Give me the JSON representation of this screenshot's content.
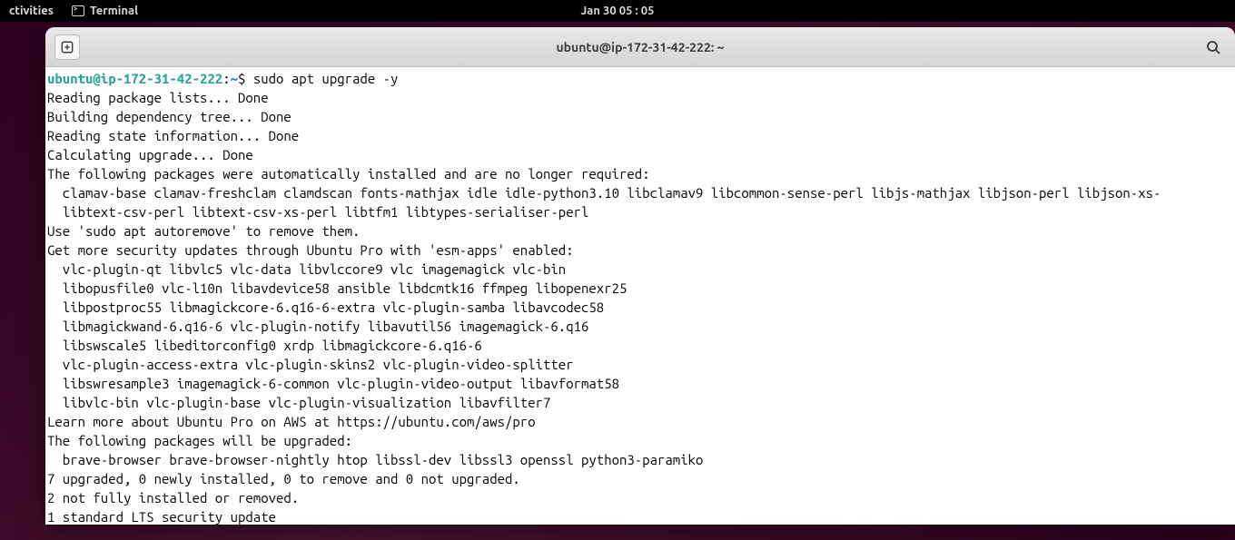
{
  "topbar": {
    "activities": "ctivities",
    "app_name": "Terminal",
    "datetime": "Jan 30  05 : 05"
  },
  "window": {
    "title": "ubuntu@ip-172-31-42-222: ~"
  },
  "prompt": {
    "userhost": "ubuntu@ip-172-31-42-222",
    "sep": ":",
    "path": "~",
    "symbol": "$ ",
    "command": "sudo apt upgrade -y"
  },
  "output": {
    "l1": "Reading package lists... Done",
    "l2": "Building dependency tree... Done",
    "l3": "Reading state information... Done",
    "l4": "Calculating upgrade... Done",
    "l5": "The following packages were automatically installed and are no longer required:",
    "l6": "  clamav-base clamav-freshclam clamdscan fonts-mathjax idle idle-python3.10 libclamav9 libcommon-sense-perl libjs-mathjax libjson-perl libjson-xs-",
    "l7": "  libtext-csv-perl libtext-csv-xs-perl libtfm1 libtypes-serialiser-perl",
    "l8": "Use 'sudo apt autoremove' to remove them.",
    "l9": "Get more security updates through Ubuntu Pro with 'esm-apps' enabled:",
    "l10": "  vlc-plugin-qt libvlc5 vlc-data libvlccore9 vlc imagemagick vlc-bin",
    "l11": "  libopusfile0 vlc-l10n libavdevice58 ansible libdcmtk16 ffmpeg libopenexr25",
    "l12": "  libpostproc55 libmagickcore-6.q16-6-extra vlc-plugin-samba libavcodec58",
    "l13": "  libmagickwand-6.q16-6 vlc-plugin-notify libavutil56 imagemagick-6.q16",
    "l14": "  libswscale5 libeditorconfig0 xrdp libmagickcore-6.q16-6",
    "l15": "  vlc-plugin-access-extra vlc-plugin-skins2 vlc-plugin-video-splitter",
    "l16": "  libswresample3 imagemagick-6-common vlc-plugin-video-output libavformat58",
    "l17": "  libvlc-bin vlc-plugin-base vlc-plugin-visualization libavfilter7",
    "l18": "Learn more about Ubuntu Pro on AWS at https://ubuntu.com/aws/pro",
    "l19": "The following packages will be upgraded:",
    "l20": "  brave-browser brave-browser-nightly htop libssl-dev libssl3 openssl python3-paramiko",
    "l21": "7 upgraded, 0 newly installed, 0 to remove and 0 not upgraded.",
    "l22": "2 not fully installed or removed.",
    "l23": "1 standard LTS security update"
  }
}
